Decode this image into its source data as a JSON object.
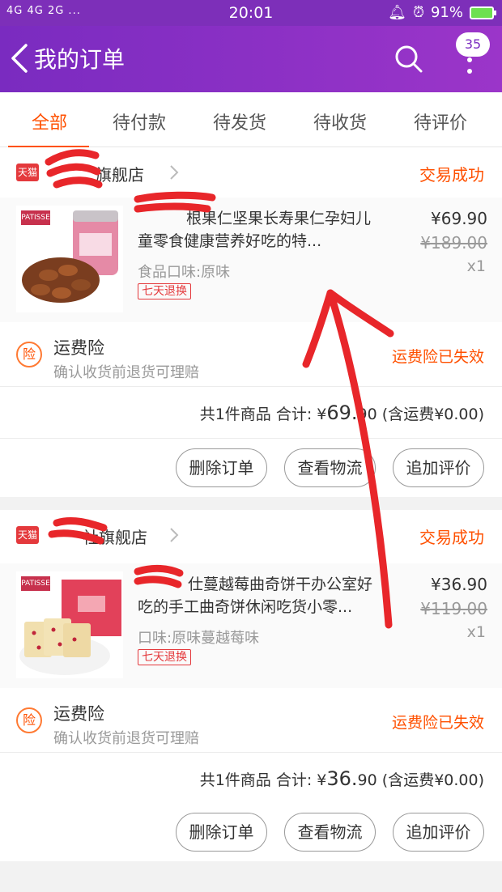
{
  "status_bar": {
    "network": "4G 4G 2G ...",
    "time": "20:01",
    "battery": "91%"
  },
  "header": {
    "title": "我的订单",
    "badge": "35"
  },
  "tabs": [
    {
      "label": "全部"
    },
    {
      "label": "待付款"
    },
    {
      "label": "待发货"
    },
    {
      "label": "待收货"
    },
    {
      "label": "待评价"
    }
  ],
  "orders": [
    {
      "shop_icon": "天猫",
      "shop_name": "旗舰店",
      "status": "交易成功",
      "item": {
        "brand": "PATISSE",
        "title": "根果仁坚果长寿果仁孕妇儿童零食健康营养好吃的特...",
        "spec": "食品口味:原味",
        "tag": "七天退换",
        "price": "¥69.90",
        "orig_price": "¥189.00",
        "qty": "x1"
      },
      "insurance": {
        "icon": "险",
        "title": "运费险",
        "desc": "确认收货前退货可理赔",
        "status": "运费险已失效"
      },
      "summary": {
        "count": "共1件商品",
        "total_label": "合计:",
        "currency": "¥",
        "total_int": "69.",
        "total_dec": "90",
        "shipping": "(含运费¥0.00)"
      },
      "actions": [
        "删除订单",
        "查看物流",
        "追加评价"
      ]
    },
    {
      "shop_icon": "天猫",
      "shop_name": "社旗舰店",
      "status": "交易成功",
      "item": {
        "brand": "PATISSE",
        "title": "仕蔓越莓曲奇饼干办公室好吃的手工曲奇饼休闲吃货小零...",
        "spec": "口味:原味蔓越莓味",
        "tag": "七天退换",
        "price": "¥36.90",
        "orig_price": "¥119.00",
        "qty": "x1"
      },
      "insurance": {
        "icon": "险",
        "title": "运费险",
        "desc": "确认收货前退货可理赔",
        "status": "运费险已失效"
      },
      "summary": {
        "count": "共1件商品",
        "total_label": "合计:",
        "currency": "¥",
        "total_int": "36.",
        "total_dec": "90",
        "shipping": "(含运费¥0.00)"
      },
      "actions": [
        "删除订单",
        "查看物流",
        "追加评价"
      ]
    }
  ],
  "colors": {
    "brand_purple": "#7a2bc0",
    "accent_orange": "#ff5000",
    "tmall_red": "#e4393c"
  }
}
